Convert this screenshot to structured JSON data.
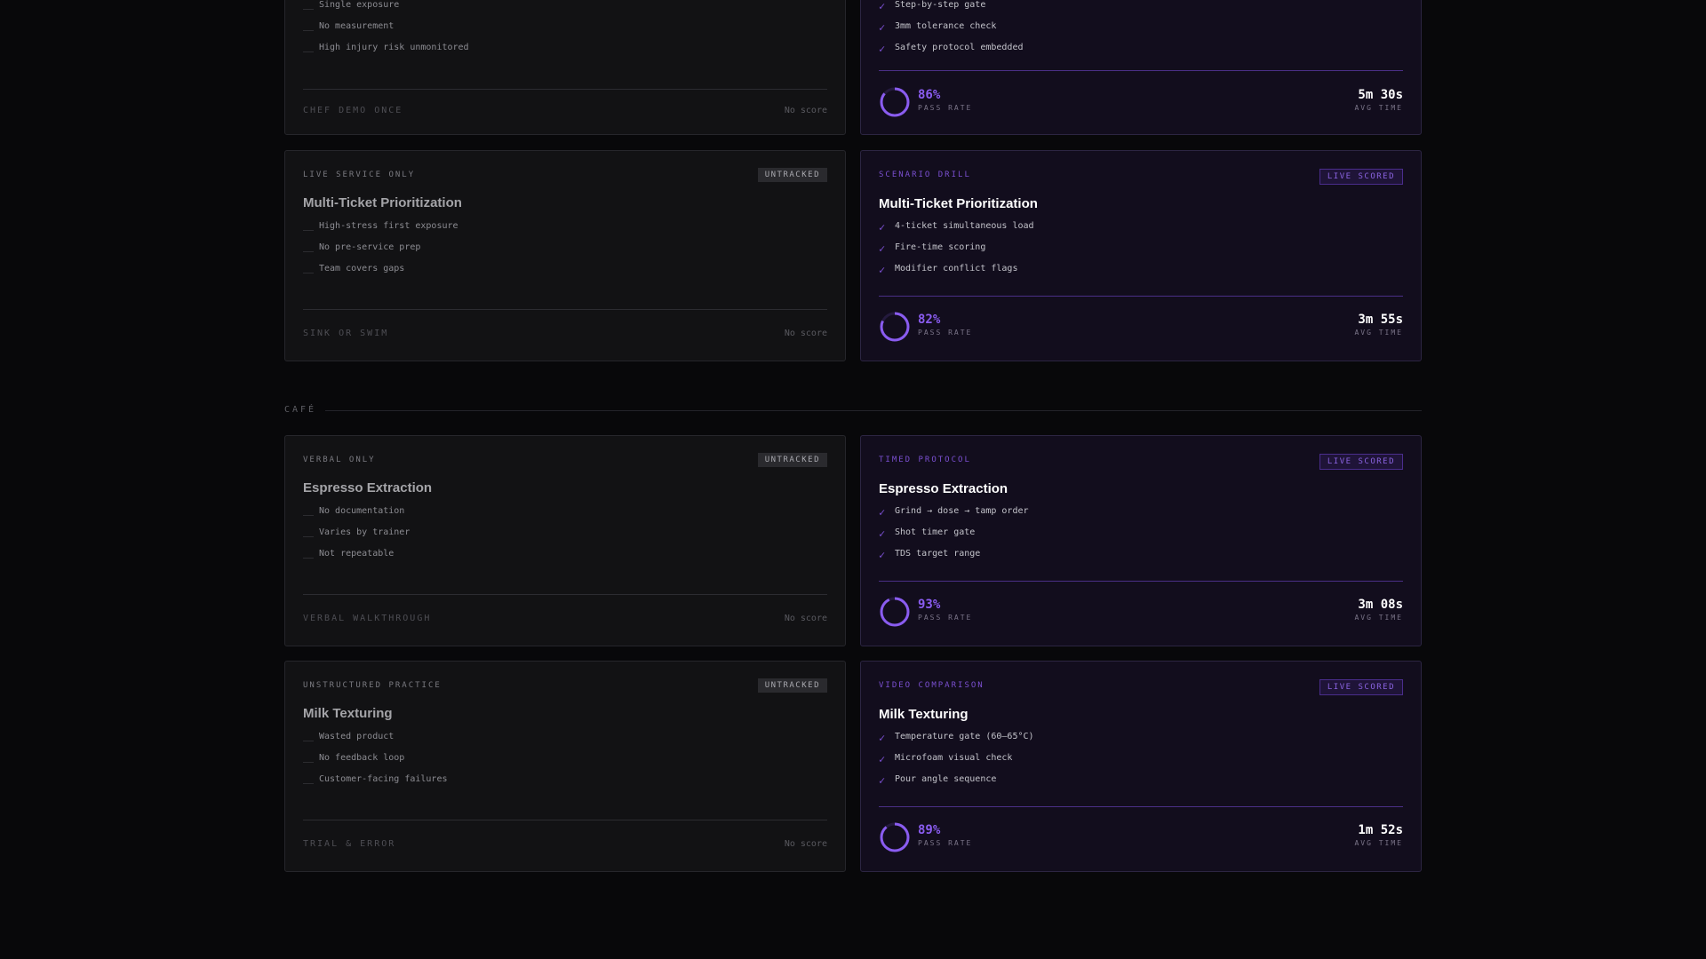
{
  "colors": {
    "background": "#08080a",
    "accent": "#8a5cf0",
    "ring_track": "#241a3e"
  },
  "section": {
    "label": "CAFÉ"
  },
  "rows": [
    {
      "old": {
        "tag": "",
        "badge": "",
        "title": "",
        "items": [
          "Single exposure",
          "No measurement",
          "High injury risk unmonitored"
        ],
        "footer_left": "CHEF DEMO ONCE",
        "footer_right": "No score"
      },
      "new": {
        "tag": "",
        "badge": "",
        "title": "",
        "items": [
          "Step-by-step gate",
          "3mm tolerance check",
          "Safety protocol embedded"
        ],
        "pass_rate": "86%",
        "pass_rate_value": 86,
        "pass_label": "PASS RATE",
        "avg_time": "5m 30s",
        "time_label": "AVG TIME"
      }
    },
    {
      "old": {
        "tag": "LIVE SERVICE ONLY",
        "badge": "UNTRACKED",
        "title": "Multi-Ticket Prioritization",
        "items": [
          "High-stress first exposure",
          "No pre-service prep",
          "Team covers gaps"
        ],
        "footer_left": "SINK OR SWIM",
        "footer_right": "No score"
      },
      "new": {
        "tag": "SCENARIO DRILL",
        "badge": "LIVE SCORED",
        "title": "Multi-Ticket Prioritization",
        "items": [
          "4-ticket simultaneous load",
          "Fire-time scoring",
          "Modifier conflict flags"
        ],
        "pass_rate": "82%",
        "pass_rate_value": 82,
        "pass_label": "PASS RATE",
        "avg_time": "3m 55s",
        "time_label": "AVG TIME"
      }
    },
    {
      "old": {
        "tag": "VERBAL ONLY",
        "badge": "UNTRACKED",
        "title": "Espresso Extraction",
        "items": [
          "No documentation",
          "Varies by trainer",
          "Not repeatable"
        ],
        "footer_left": "VERBAL WALKTHROUGH",
        "footer_right": "No score"
      },
      "new": {
        "tag": "TIMED PROTOCOL",
        "badge": "LIVE SCORED",
        "title": "Espresso Extraction",
        "items": [
          "Grind → dose → tamp order",
          "Shot timer gate",
          "TDS target range"
        ],
        "pass_rate": "93%",
        "pass_rate_value": 93,
        "pass_label": "PASS RATE",
        "avg_time": "3m 08s",
        "time_label": "AVG TIME"
      }
    },
    {
      "old": {
        "tag": "UNSTRUCTURED PRACTICE",
        "badge": "UNTRACKED",
        "title": "Milk Texturing",
        "items": [
          "Wasted product",
          "No feedback loop",
          "Customer-facing failures"
        ],
        "footer_left": "TRIAL & ERROR",
        "footer_right": "No score"
      },
      "new": {
        "tag": "VIDEO COMPARISON",
        "badge": "LIVE SCORED",
        "title": "Milk Texturing",
        "items": [
          "Temperature gate (60–65°C)",
          "Microfoam visual check",
          "Pour angle sequence"
        ],
        "pass_rate": "89%",
        "pass_rate_value": 89,
        "pass_label": "PASS RATE",
        "avg_time": "1m 52s",
        "time_label": "AVG TIME"
      }
    }
  ]
}
